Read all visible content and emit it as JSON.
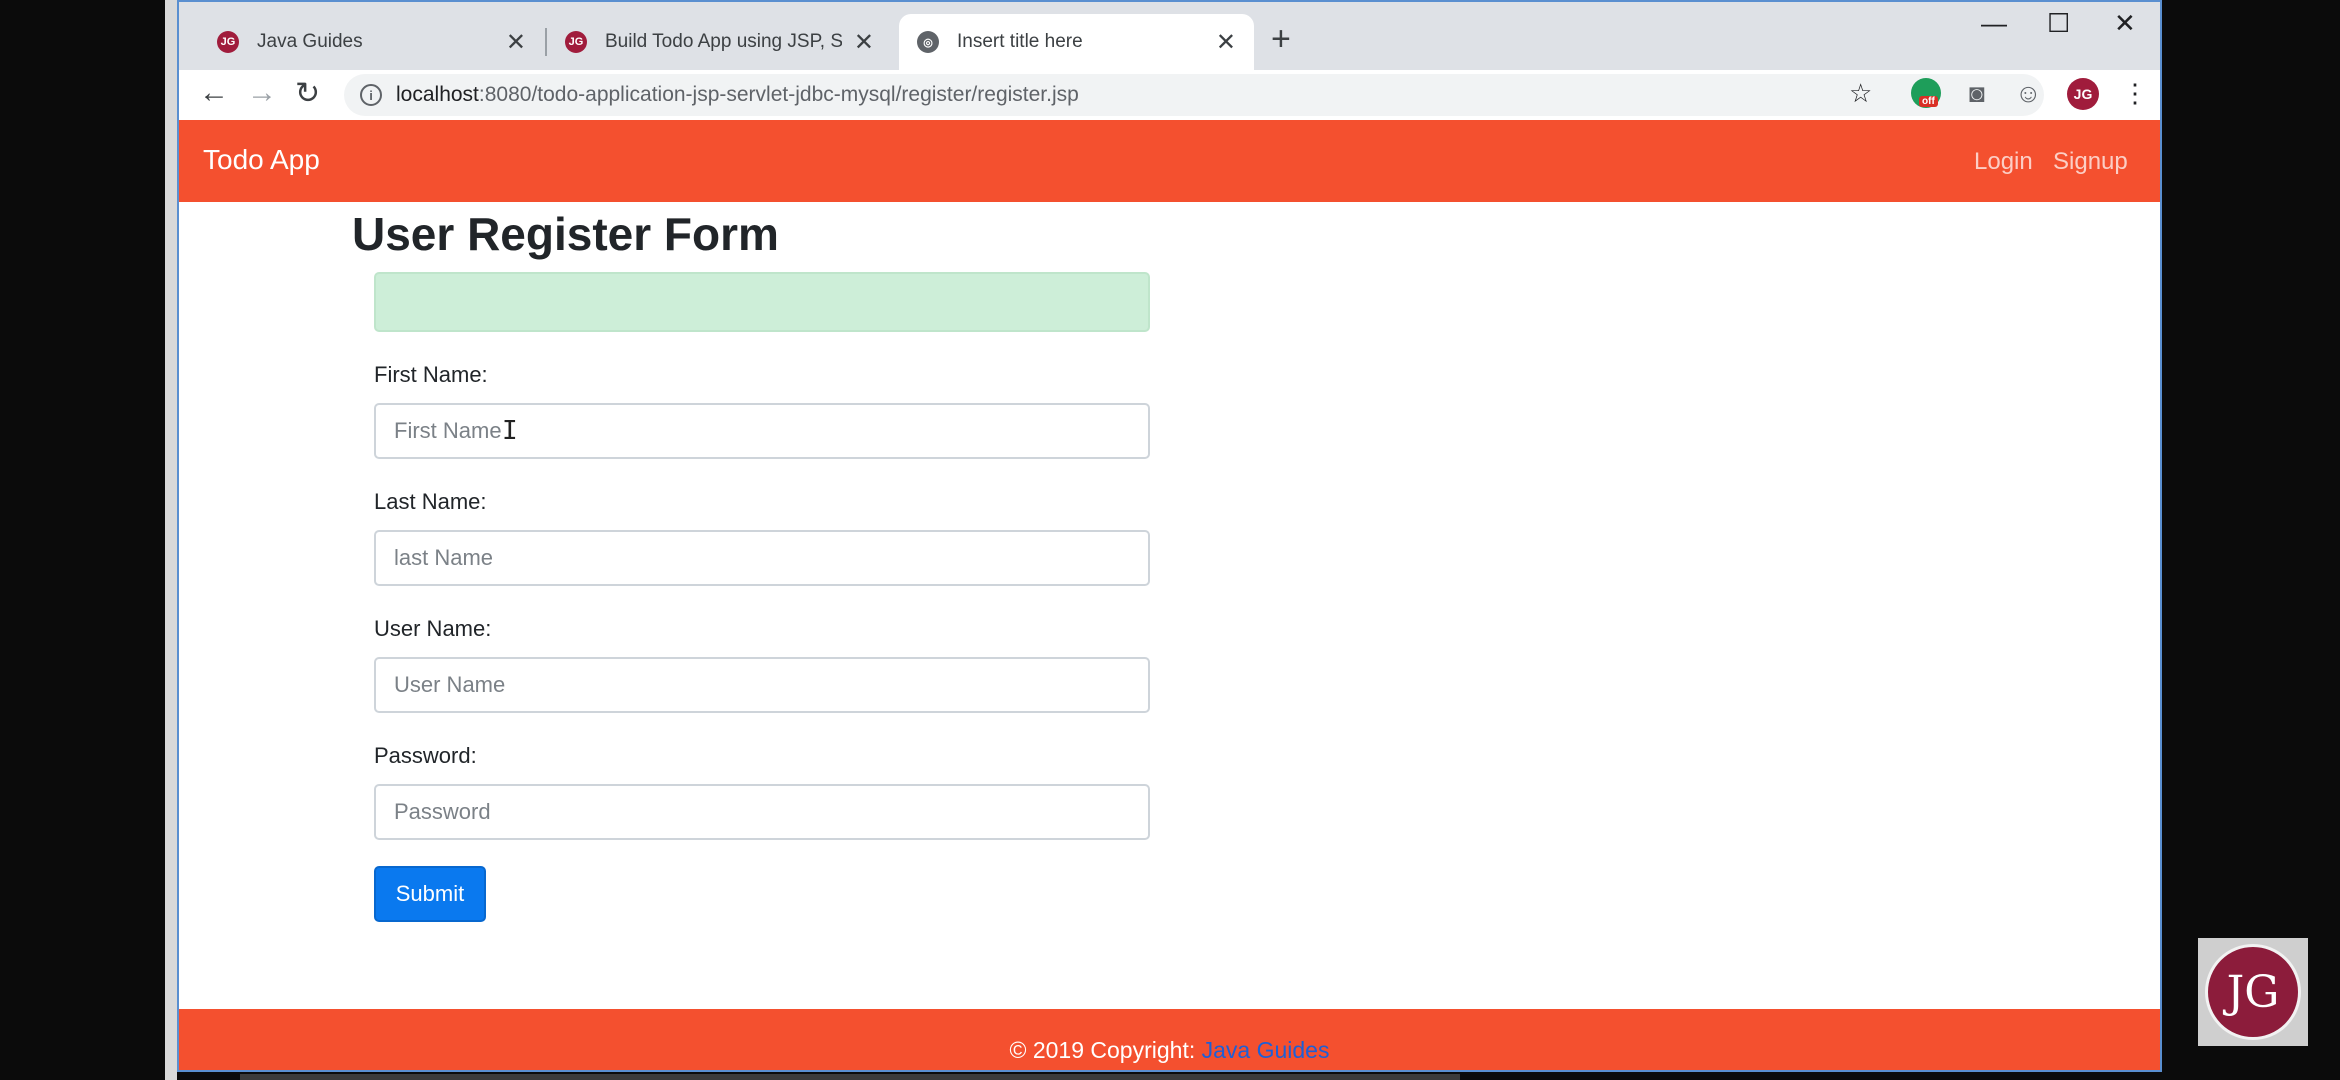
{
  "browser": {
    "tabs": [
      {
        "label": "Java Guides",
        "close": "✕"
      },
      {
        "label": "Build Todo App using JSP, Servlet",
        "close": "✕"
      },
      {
        "label": "Insert title here",
        "close": "✕"
      }
    ],
    "new_tab": "+",
    "window_controls": {
      "minimize": "—",
      "maximize": "☐",
      "close": "✕"
    },
    "url": {
      "host": "localhost",
      "rest": ":8080/todo-application-jsp-servlet-jdbc-mysql/register/register.jsp"
    },
    "extension_badge": "off",
    "profile_initials": "JG"
  },
  "app": {
    "brand": "Todo App",
    "nav": {
      "login": "Login",
      "signup": "Signup"
    },
    "form": {
      "title": "User Register Form",
      "first_name_label": "First Name:",
      "first_name_placeholder": "First Name",
      "last_name_label": "Last Name:",
      "last_name_placeholder": "last Name",
      "username_label": "User Name:",
      "username_placeholder": "User Name",
      "password_label": "Password:",
      "password_placeholder": "Password",
      "submit": "Submit"
    },
    "footer": {
      "text": "© 2019 Copyright: ",
      "link": "Java Guides"
    }
  },
  "overlay": {
    "logo_text": "JG"
  },
  "colors": {
    "nav_bg": "#f4502f",
    "primary_button": "#0a79ef",
    "alert_bg": "#cdeed8"
  }
}
